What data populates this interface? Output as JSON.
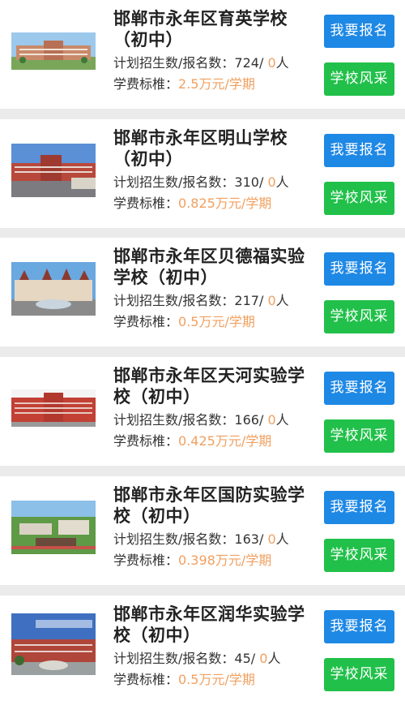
{
  "schools": [
    {
      "name": "邯郸市永年区育英学校（初中）",
      "enroll_label": "计划招生数/报名数：",
      "planned": "724",
      "separator": "/ ",
      "registered": "0",
      "unit": "人",
      "fee_label": "学费标椎：",
      "fee": "2.5万元/学期",
      "signup_label": "我要报名",
      "style_label": "学校风采"
    },
    {
      "name": "邯郸市永年区明山学校（初中）",
      "enroll_label": "计划招生数/报名数：",
      "planned": "310",
      "separator": "/ ",
      "registered": "0",
      "unit": "人",
      "fee_label": "学费标椎：",
      "fee": "0.825万元/学期",
      "signup_label": "我要报名",
      "style_label": "学校风采"
    },
    {
      "name": "邯郸市永年区贝德福实验学校（初中）",
      "enroll_label": "计划招生数/报名数：",
      "planned": "217",
      "separator": "/ ",
      "registered": "0",
      "unit": "人",
      "fee_label": "学费标椎：",
      "fee": "0.5万元/学期",
      "signup_label": "我要报名",
      "style_label": "学校风采"
    },
    {
      "name": "邯郸市永年区天河实验学校（初中）",
      "enroll_label": "计划招生数/报名数：",
      "planned": "166",
      "separator": "/ ",
      "registered": "0",
      "unit": "人",
      "fee_label": "学费标椎：",
      "fee": "0.425万元/学期",
      "signup_label": "我要报名",
      "style_label": "学校风采"
    },
    {
      "name": "邯郸市永年区国防实验学校（初中）",
      "enroll_label": "计划招生数/报名数：",
      "planned": "163",
      "separator": "/ ",
      "registered": "0",
      "unit": "人",
      "fee_label": "学费标椎：",
      "fee": "0.398万元/学期",
      "signup_label": "我要报名",
      "style_label": "学校风采"
    },
    {
      "name": "邯郸市永年区润华实验学校（初中）",
      "enroll_label": "计划招生数/报名数：",
      "planned": "45",
      "separator": "/ ",
      "registered": "0",
      "unit": "人",
      "fee_label": "学费标椎：",
      "fee": "0.5万元/学期",
      "signup_label": "我要报名",
      "style_label": "学校风采"
    }
  ],
  "colors": {
    "signup_button": "#1e88e5",
    "style_button": "#21c04a",
    "fee_and_count": "#f0a060",
    "card_background": "#ffffff",
    "page_background": "#ebebeb"
  }
}
